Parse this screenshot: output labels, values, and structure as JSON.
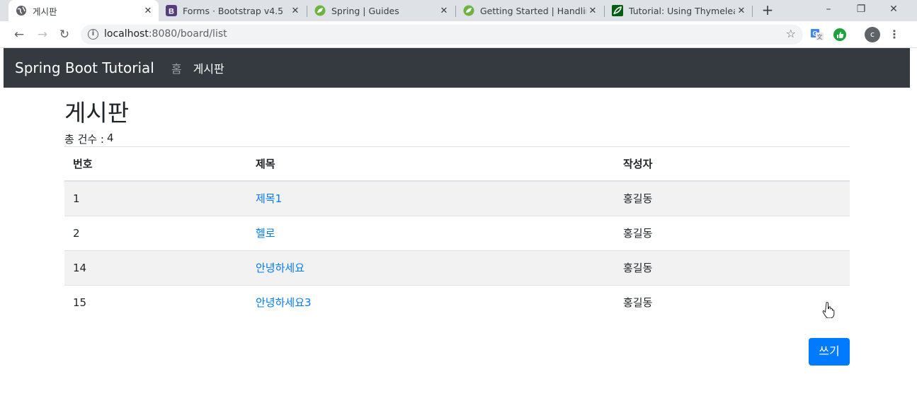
{
  "browser": {
    "tabs": [
      {
        "title": "게시판",
        "icon": "globe-icon",
        "close": "✕"
      },
      {
        "title": "Forms · Bootstrap v4.5",
        "icon": "bootstrap-icon",
        "close": "✕"
      },
      {
        "title": "Spring | Guides",
        "icon": "spring-icon",
        "close": "✕"
      },
      {
        "title": "Getting Started | Handling",
        "icon": "spring-icon",
        "close": "✕"
      },
      {
        "title": "Tutorial: Using Thymeleaf",
        "icon": "thymeleaf-icon",
        "close": "✕"
      }
    ],
    "new_tab": "+",
    "window_controls": {
      "minimize": "–",
      "restore": "❐",
      "close": "✕"
    },
    "nav": {
      "back": "←",
      "forward": "→",
      "reload": "↻"
    },
    "url_host": "localhost",
    "url_rest": ":8080/board/list",
    "bookmark": "☆",
    "profile_initial": "c",
    "menu": "⋮"
  },
  "navbar": {
    "brand": "Spring Boot Tutorial",
    "links": [
      {
        "label": "홈",
        "active": false
      },
      {
        "label": "게시판",
        "active": true
      }
    ],
    "background": "#343a40"
  },
  "page": {
    "title": "게시판",
    "count_label": "총 건수 :",
    "count_value": "4"
  },
  "table": {
    "headers": [
      "번호",
      "제목",
      "작성자"
    ],
    "rows": [
      {
        "no": "1",
        "title": "제목1",
        "author": "홍길동"
      },
      {
        "no": "2",
        "title": "헬로",
        "author": "홍길동"
      },
      {
        "no": "14",
        "title": "안녕하세요",
        "author": "홍길동"
      },
      {
        "no": "15",
        "title": "안녕하세요3",
        "author": "홍길동"
      }
    ]
  },
  "write_button": {
    "label": "쓰기",
    "color": "#007bff"
  },
  "colors": {
    "link": "#007bff",
    "stripe": "#f2f2f2"
  }
}
